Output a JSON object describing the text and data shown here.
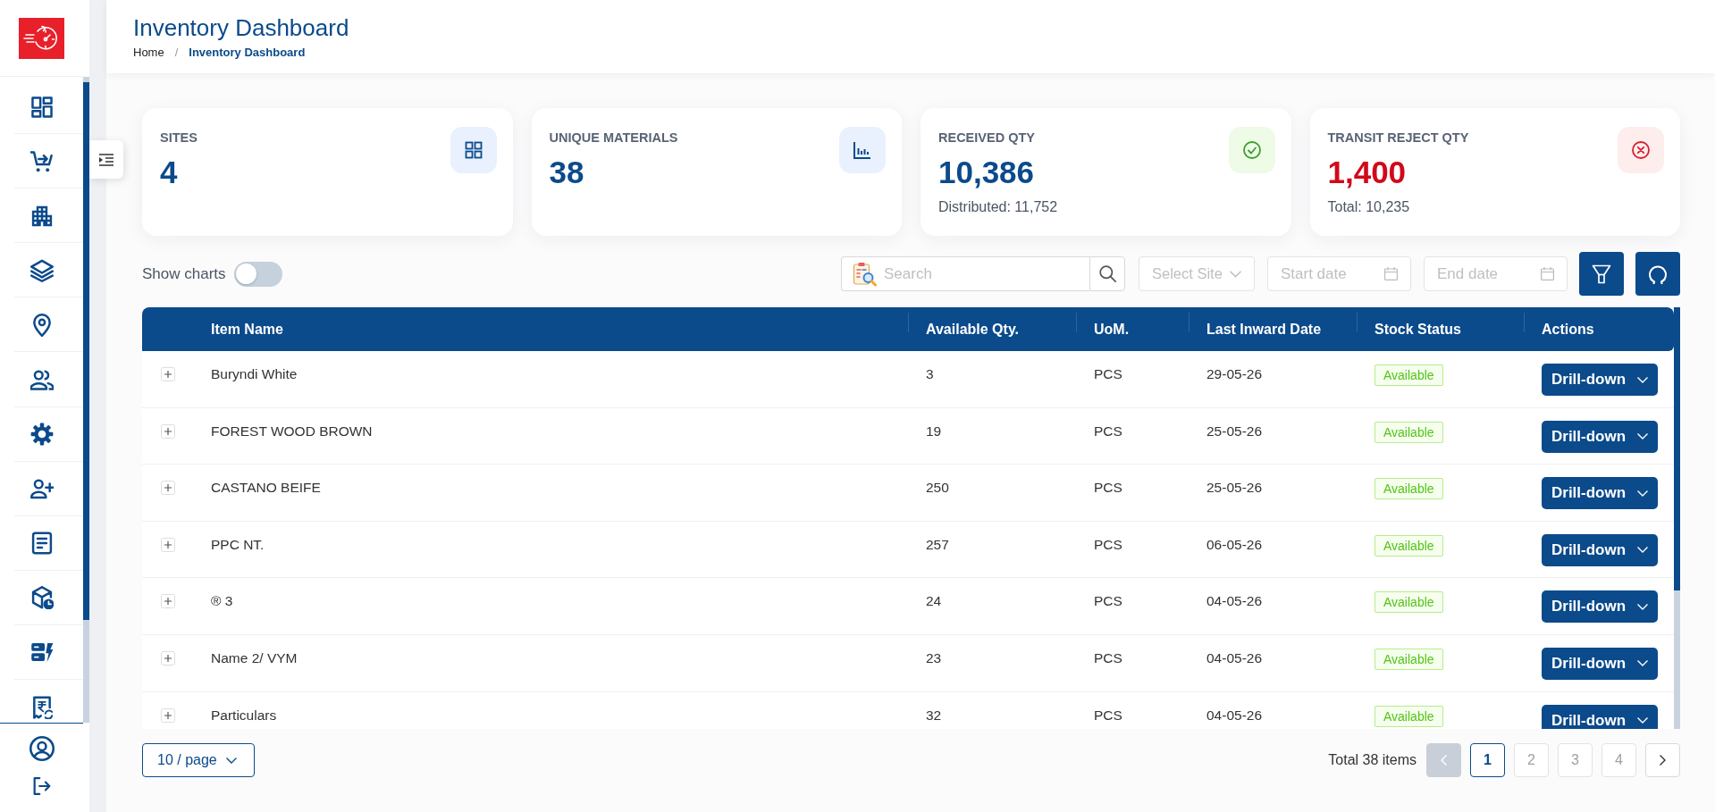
{
  "header": {
    "title": "Inventory Dashboard",
    "breadcrumb": [
      {
        "label": "Home",
        "current": false
      },
      {
        "label": "Inventory Dashboard",
        "current": true
      }
    ],
    "separator": "/"
  },
  "stats": [
    {
      "kind": "grid",
      "label": "SITES",
      "value": "4",
      "color": "#0b4a8b"
    },
    {
      "kind": "chart",
      "label": "UNIQUE MATERIALS",
      "value": "38",
      "color": "#0b4a8b"
    },
    {
      "kind": "check",
      "label": "RECEIVED QTY",
      "value": "10,386",
      "color": "#0b4a8b",
      "note": "Distributed: 11,752"
    },
    {
      "kind": "cross",
      "label": "TRANSIT REJECT QTY",
      "value": "1,400",
      "color": "#d2091a",
      "note": "Total: 10,235"
    }
  ],
  "toolbar": {
    "show_charts": {
      "label": "Show charts",
      "on": false
    },
    "search": {
      "placeholder": "Search"
    },
    "site": {
      "placeholder": "Select Site"
    },
    "start_date": {
      "placeholder": "Start date"
    },
    "end_date": {
      "placeholder": "End date"
    }
  },
  "table": {
    "columns": [
      "Item Name",
      "Available Qty.",
      "UoM.",
      "Last Inward Date",
      "Stock Status",
      "Actions"
    ],
    "rows": [
      {
        "expanded": false,
        "item_name": "Buryndi White",
        "available_qty": "3",
        "uom": "PCS",
        "last_inward_date": "29-05-26",
        "stock_status": "Available",
        "action": "Drill-down"
      },
      {
        "expanded": false,
        "item_name": "FOREST WOOD BROWN",
        "available_qty": "19",
        "uom": "PCS",
        "last_inward_date": "25-05-26",
        "stock_status": "Available",
        "action": "Drill-down"
      },
      {
        "expanded": false,
        "item_name": "CASTANO BEIFE",
        "available_qty": "250",
        "uom": "PCS",
        "last_inward_date": "25-05-26",
        "stock_status": "Available",
        "action": "Drill-down"
      },
      {
        "expanded": false,
        "item_name": "PPC NT.",
        "available_qty": "257",
        "uom": "PCS",
        "last_inward_date": "06-05-26",
        "stock_status": "Available",
        "action": "Drill-down"
      },
      {
        "expanded": false,
        "item_name": "® 3",
        "available_qty": "24",
        "uom": "PCS",
        "last_inward_date": "04-05-26",
        "stock_status": "Available",
        "action": "Drill-down"
      },
      {
        "expanded": false,
        "item_name": "Name 2/ VYM",
        "available_qty": "23",
        "uom": "PCS",
        "last_inward_date": "04-05-26",
        "stock_status": "Available",
        "action": "Drill-down"
      },
      {
        "expanded": false,
        "item_name": "Particulars",
        "available_qty": "32",
        "uom": "PCS",
        "last_inward_date": "04-05-26",
        "stock_status": "Available",
        "action": "Drill-down"
      }
    ]
  },
  "pagination": {
    "page_size": "10 / page",
    "total": "Total 38 items",
    "prev": {
      "disabled": true
    },
    "pages": [
      {
        "label": "1",
        "selected": true
      },
      {
        "label": "2",
        "selected": false
      },
      {
        "label": "3",
        "selected": false
      },
      {
        "label": "4",
        "selected": false
      }
    ],
    "next": {
      "disabled": false
    }
  }
}
